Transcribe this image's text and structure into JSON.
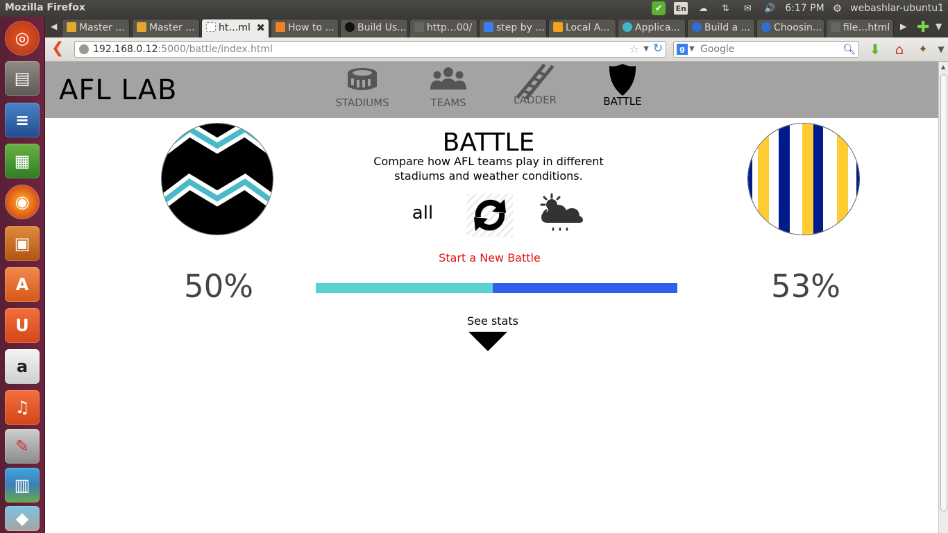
{
  "os": {
    "window_title": "Mozilla Firefox",
    "language_indicator": "En",
    "clock": "6:17 PM",
    "user": "webashlar-ubuntu1"
  },
  "launcher": {
    "items": [
      "dash-home",
      "files",
      "writer",
      "calc",
      "firefox",
      "impress",
      "software-center",
      "ubuntu-one",
      "amazon",
      "ubuntu-one-music",
      "system-settings",
      "workspaces"
    ]
  },
  "tabs": [
    {
      "label": "Master ...",
      "active": false
    },
    {
      "label": "Master ...",
      "active": false
    },
    {
      "label": "ht…ml",
      "active": true
    },
    {
      "label": "How to ...",
      "active": false
    },
    {
      "label": "Build Us...",
      "active": false
    },
    {
      "label": "http…00/",
      "active": false
    },
    {
      "label": "step by ...",
      "active": false
    },
    {
      "label": "Local A...",
      "active": false
    },
    {
      "label": "Applica...",
      "active": false
    },
    {
      "label": "Build a ...",
      "active": false
    },
    {
      "label": "Choosin...",
      "active": false
    },
    {
      "label": "file…html",
      "active": false
    }
  ],
  "navbar": {
    "url_host": "192.168.0.12",
    "url_rest": ":5000/battle/index.html",
    "search_placeholder": "Google"
  },
  "site": {
    "logo": "AFL LAB",
    "nav": [
      {
        "label": "STADIUMS",
        "icon": "stadium-icon",
        "current": false
      },
      {
        "label": "TEAMS",
        "icon": "teams-icon",
        "current": false
      },
      {
        "label": "LADDER",
        "icon": "ladder-icon",
        "current": false
      },
      {
        "label": "BATTLE",
        "icon": "shield-icon",
        "current": true
      }
    ]
  },
  "battle": {
    "title": "BATTLE",
    "description": "Compare how AFL teams play in different stadiums and weather conditions.",
    "filter_label": "all",
    "new_battle_label": "Start a New Battle",
    "left_team": {
      "percent_label": "50%",
      "colors": [
        "#000000",
        "#4bbac8",
        "#ffffff"
      ]
    },
    "right_team": {
      "percent_label": "53%",
      "colors": [
        "#ffffff",
        "#ffcc33",
        "#001c8c"
      ]
    },
    "bar": {
      "left_fraction": 0.49,
      "left_color": "#57d3d3",
      "right_color": "#2f5ef2"
    },
    "see_stats_label": "See stats"
  }
}
